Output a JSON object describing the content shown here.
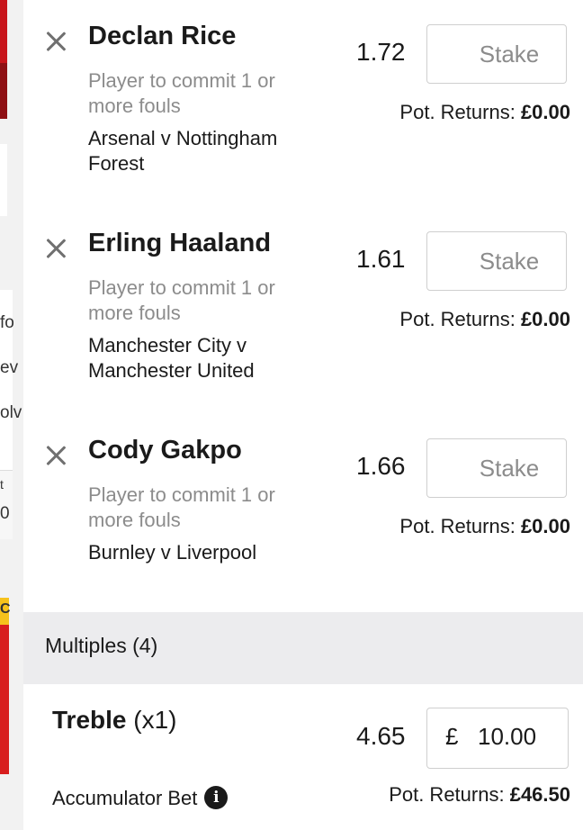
{
  "selections": [
    {
      "player": "Declan Rice",
      "market": "Player to commit 1 or more fouls",
      "event": "Arsenal v Nottingham Forest",
      "odds": "1.72",
      "stake_placeholder": "Stake",
      "returns_label": "Pot. Returns:",
      "returns_value": "£0.00"
    },
    {
      "player": "Erling Haaland",
      "market": "Player to commit 1 or more fouls",
      "event": "Manchester City v Manchester United",
      "odds": "1.61",
      "stake_placeholder": "Stake",
      "returns_label": "Pot. Returns:",
      "returns_value": "£0.00"
    },
    {
      "player": "Cody Gakpo",
      "market": "Player to commit 1 or more fouls",
      "event": "Burnley v Liverpool",
      "odds": "1.66",
      "stake_placeholder": "Stake",
      "returns_label": "Pot. Returns:",
      "returns_value": "£0.00"
    }
  ],
  "multiples": {
    "header": "Multiples (4)",
    "treble": {
      "name": "Treble",
      "count": "(x1)",
      "odds": "4.65",
      "currency": "£",
      "stake": "10.00",
      "bet_type": "Accumulator Bet",
      "info_icon": "info-icon",
      "returns_label": "Pot. Returns:",
      "returns_value": "£46.50"
    }
  },
  "background_fragments": [
    "fo",
    "ev",
    "olv",
    "t",
    "0",
    "C"
  ],
  "colors": {
    "accent_red": "#c8151b",
    "header_grey": "#ececee",
    "muted_text": "#8c8c8c"
  }
}
